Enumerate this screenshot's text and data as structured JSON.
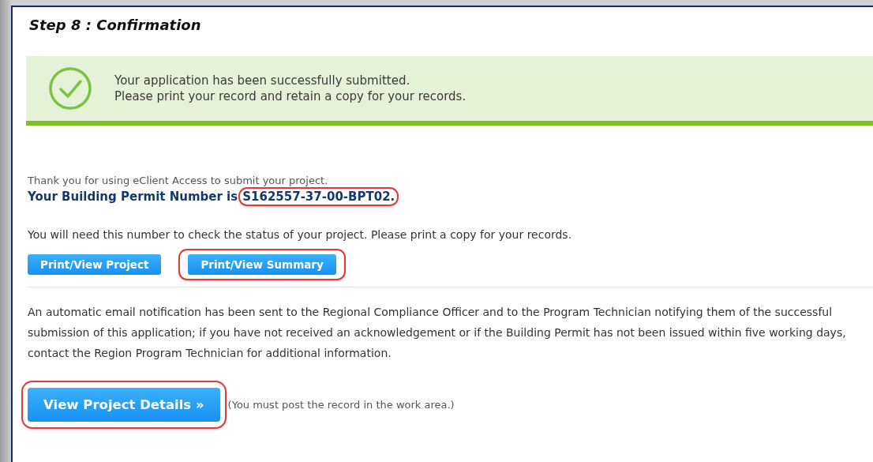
{
  "heading": "Step 8 : Confirmation",
  "banner": {
    "lines": [
      "Your application has been successfully submitted.",
      "Please print your record and retain a copy for your records."
    ]
  },
  "thanks": "Thank you for using eClient Access to submit your project.",
  "permit": {
    "label": "Your Building Permit Number is",
    "number": "S162557-37-00-BPT02.",
    "highlighted": true
  },
  "notice": "You will need this number to check the status of your project. Please print a copy for your records.",
  "print_buttons": [
    {
      "label": "Print/View Project",
      "highlighted": false
    },
    {
      "label": "Print/View Summary",
      "highlighted": true
    }
  ],
  "email_notice": "An automatic email notification has been sent to the Regional Compliance Officer and to the Program Technician notifying them of the successful submission of this application; if you have not received an acknowledgement or if the Building Permit has not been issued within five working days, contact the Region Program Technician for additional information.",
  "details_button": {
    "label": "View Project Details »",
    "highlighted": true
  },
  "details_note": "(You must post the record in the work area.)"
}
